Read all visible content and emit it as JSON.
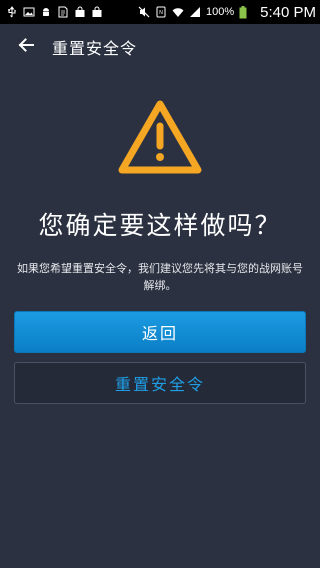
{
  "status_bar": {
    "battery_percent_text": "100%",
    "clock": "5:40 PM",
    "left_icons": [
      "usb-icon",
      "image-icon",
      "android-icon",
      "document-icon",
      "shopping-bag-icon",
      "shopping-bag-icon"
    ],
    "right_icons": [
      "mute-icon",
      "nfc-icon",
      "wifi-icon",
      "signal-icon",
      "battery-icon"
    ]
  },
  "app_bar": {
    "title": "重置安全令",
    "back_icon": "arrow-left-icon"
  },
  "warning": {
    "icon": "warning-triangle-icon",
    "color": "#f5a623"
  },
  "headline": "您确定要这样做吗？",
  "description": "如果您希望重置安全令，我们建议您先将其与您的战网账号解绑。",
  "buttons": {
    "back_label": "返回",
    "reset_label": "重置安全令"
  },
  "colors": {
    "background": "#2b3140",
    "primary_button": "#1b95dc",
    "secondary_text": "#1f9fe8"
  }
}
